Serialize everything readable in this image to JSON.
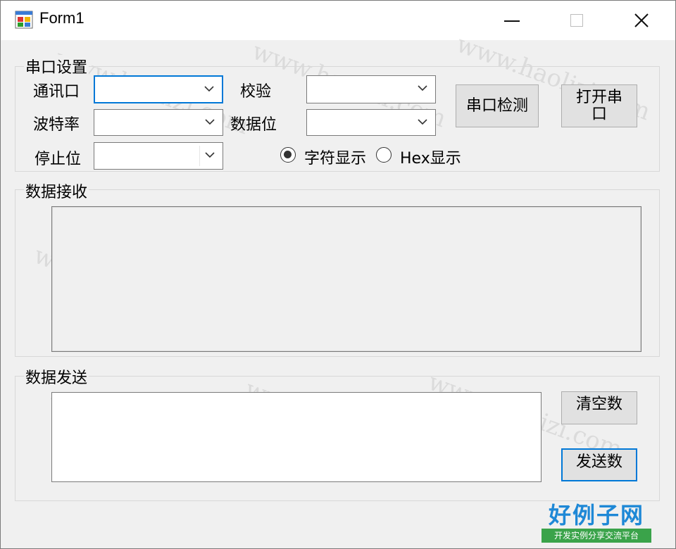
{
  "window": {
    "title": "Form1"
  },
  "serial_settings": {
    "group_label": "串口设置",
    "port_label": "通讯口",
    "baud_label": "波特率",
    "stop_label": "停止位",
    "parity_label": "校验",
    "data_bits_label": "数据位",
    "port_value": "",
    "baud_value": "",
    "stop_value": "",
    "parity_value": "",
    "data_bits_value": "",
    "detect_button": "串口检测",
    "open_button_line1": "打开串",
    "open_button_line2": "口",
    "display_mode": {
      "char_label": "字符显示",
      "hex_label": "Hex显示",
      "selected": "char"
    }
  },
  "receive": {
    "group_label": "数据接收",
    "text": ""
  },
  "send": {
    "group_label": "数据发送",
    "text": "",
    "clear_button": "清空数",
    "send_button": "发送数"
  },
  "watermark": {
    "text": "www.haolizi.com"
  },
  "logo": {
    "main": "好例子网",
    "sub": "开发实例分享交流平台"
  },
  "colors": {
    "focus_accent": "#0078d7",
    "logo_blue": "#1e88d6",
    "logo_green": "#3aa34a"
  }
}
